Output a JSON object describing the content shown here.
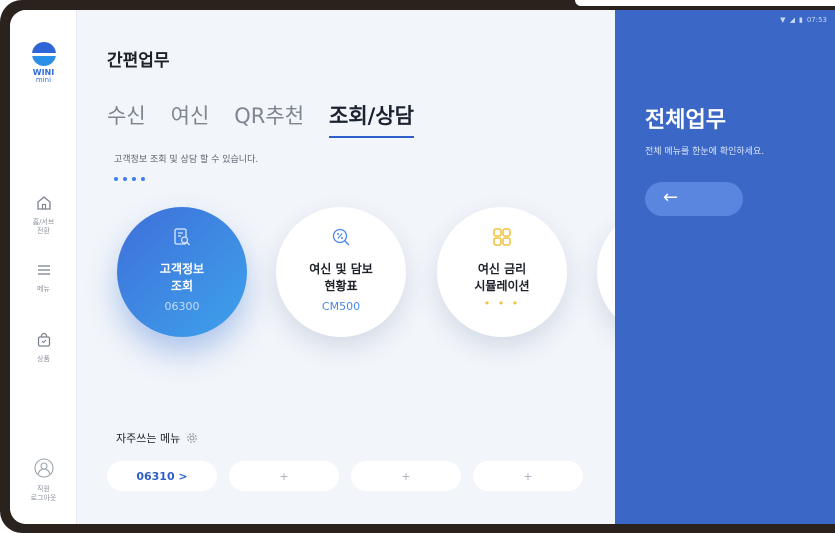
{
  "status_bar": {
    "time": "07:53"
  },
  "brand": {
    "name": "WINI",
    "sub": "mini"
  },
  "sidebar": {
    "items": [
      {
        "id": "home",
        "label": "홈/서브\n전환"
      },
      {
        "id": "menu",
        "label": "메뉴"
      },
      {
        "id": "product",
        "label": "상품"
      },
      {
        "id": "user",
        "label": "직원\n로그아웃"
      }
    ]
  },
  "main": {
    "title": "간편업무",
    "tabs": [
      {
        "label": "수신",
        "active": false
      },
      {
        "label": "여신",
        "active": false
      },
      {
        "label": "QR추천",
        "active": false
      },
      {
        "label": "조회/상담",
        "active": true
      }
    ],
    "description": "고객정보 조회 및 상담 할 수 있습니다.",
    "page_dots": 4,
    "cards": [
      {
        "title": "고객정보\n조회",
        "code": "06300",
        "icon": "search-doc-icon",
        "active": true
      },
      {
        "title": "여신 및 담보\n현황표",
        "code": "CM500",
        "icon": "percent-search-icon",
        "active": false
      },
      {
        "title": "여신 금리\n시뮬레이션",
        "code": "• • •",
        "icon": "grid-apps-icon",
        "active": false
      }
    ],
    "favorites": {
      "title": "자주쓰는 메뉴",
      "items": [
        {
          "label": "06310 >",
          "filled": true
        },
        {
          "label": "+",
          "filled": false
        },
        {
          "label": "+",
          "filled": false
        },
        {
          "label": "+",
          "filled": false
        }
      ]
    }
  },
  "panel": {
    "title": "전체업무",
    "subtitle": "전체 메뉴를 한눈에 확인하세요.",
    "back_label": "←"
  },
  "colors": {
    "accent": "#3b68c6",
    "active_start": "#3f6fd9",
    "active_end": "#3da2ec",
    "dot": "#3f7ef0"
  }
}
